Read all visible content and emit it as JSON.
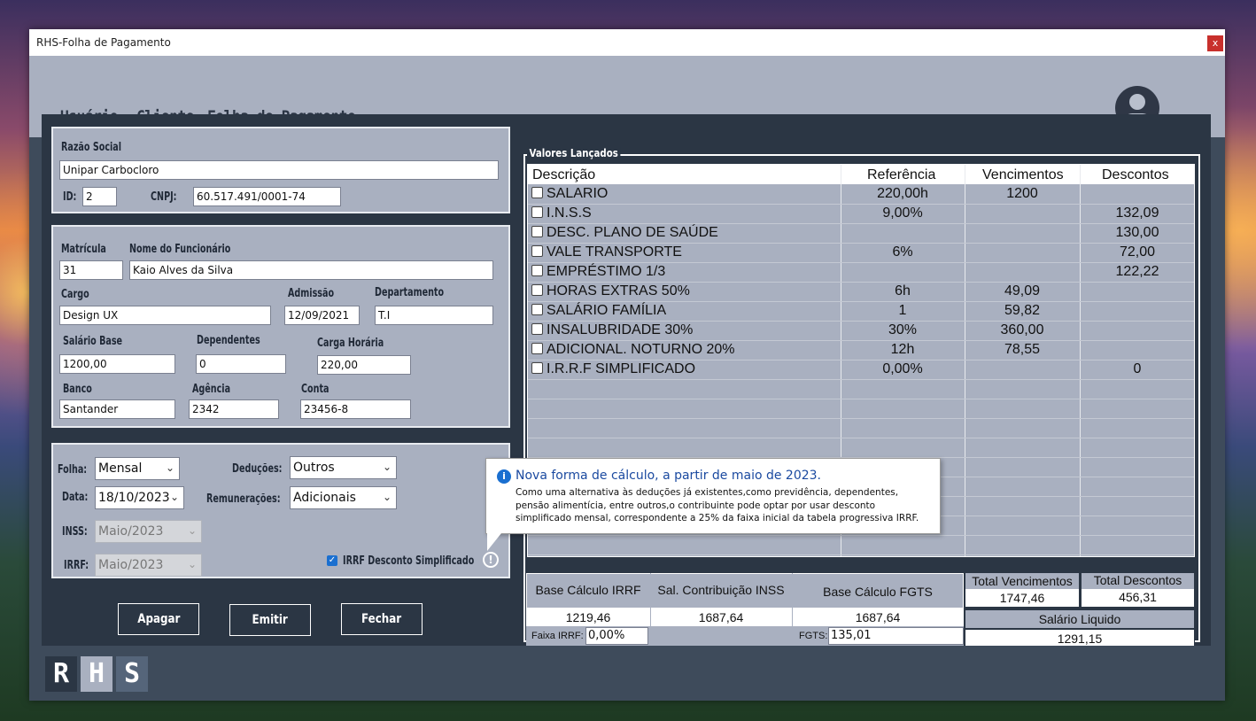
{
  "window": {
    "title": "RHS-Folha de Pagamento",
    "close_label": "x"
  },
  "menu": {
    "items": [
      "Usuário",
      "Cliente",
      "Folha de Pagamento"
    ]
  },
  "empresa": {
    "razao_label": "Razão Social",
    "razao_value": "Unipar Carbocloro",
    "id_label": "ID:",
    "id_value": "2",
    "cnpj_label": "CNPJ:",
    "cnpj_value": "60.517.491/0001-74"
  },
  "funcionario": {
    "matricula_label": "Matrícula",
    "matricula_value": "31",
    "nome_label": "Nome do Funcionário",
    "nome_value": "Kaio Alves da Silva",
    "cargo_label": "Cargo",
    "cargo_value": "Design UX",
    "admissao_label": "Admissão",
    "admissao_value": "12/09/2021",
    "departamento_label": "Departamento",
    "departamento_value": "T.I",
    "salario_label": "Salário Base",
    "salario_value": "1200,00",
    "dependentes_label": "Dependentes",
    "dependentes_value": "0",
    "carga_label": "Carga Horária",
    "carga_value": "220,00",
    "banco_label": "Banco",
    "banco_value": "Santander",
    "agencia_label": "Agência",
    "agencia_value": "2342",
    "conta_label": "Conta",
    "conta_value": "23456-8"
  },
  "folha": {
    "folha_label": "Folha:",
    "folha_value": "Mensal",
    "data_label": "Data:",
    "data_value": "18/10/2023",
    "inss_label": "INSS:",
    "inss_value": "Maio/2023",
    "irrf_label": "IRRF:",
    "irrf_value": "Maio/2023",
    "deducoes_label": "Deduções:",
    "deducoes_value": "Outros",
    "remuneracoes_label": "Remunerações:",
    "remuneracoes_value": "Adicionais",
    "irrf_checkbox_label": "IRRF Desconto Simplificado",
    "irrf_checkbox_checked": true
  },
  "buttons": {
    "apagar": "Apagar",
    "emitir": "Emitir",
    "fechar": "Fechar"
  },
  "valores": {
    "legend": "Valores Lançados",
    "headers": [
      "Descrição",
      "Referência",
      "Vencimentos",
      "Descontos"
    ],
    "rows": [
      {
        "descricao": "SALARIO",
        "referencia": "220,00h",
        "vencimentos": "1200",
        "descontos": ""
      },
      {
        "descricao": "I.N.S.S",
        "referencia": "9,00%",
        "vencimentos": "",
        "descontos": "132,09"
      },
      {
        "descricao": "DESC. PLANO DE SAÚDE",
        "referencia": "",
        "vencimentos": "",
        "descontos": "130,00"
      },
      {
        "descricao": "VALE TRANSPORTE",
        "referencia": "6%",
        "vencimentos": "",
        "descontos": "72,00"
      },
      {
        "descricao": "EMPRÉSTIMO 1/3",
        "referencia": "",
        "vencimentos": "",
        "descontos": "122,22"
      },
      {
        "descricao": "HORAS EXTRAS 50%",
        "referencia": "6h",
        "vencimentos": "49,09",
        "descontos": ""
      },
      {
        "descricao": "SALÁRIO FAMÍLIA",
        "referencia": "1",
        "vencimentos": "59,82",
        "descontos": ""
      },
      {
        "descricao": "INSALUBRIDADE 30%",
        "referencia": "30%",
        "vencimentos": "360,00",
        "descontos": ""
      },
      {
        "descricao": "ADICIONAL. NOTURNO 20%",
        "referencia": "12h",
        "vencimentos": "78,55",
        "descontos": ""
      },
      {
        "descricao": "I.R.R.F SIMPLIFICADO",
        "referencia": "0,00%",
        "vencimentos": "",
        "descontos": "0"
      }
    ]
  },
  "totais": {
    "base_irrf_label": "Base Cálculo IRRF",
    "base_irrf_value": "1219,46",
    "sal_inss_label": "Sal. Contribuição INSS",
    "sal_inss_value": "1687,64",
    "base_fgts_label": "Base Cálculo FGTS",
    "base_fgts_value": "1687,64",
    "total_venc_label": "Total Vencimentos",
    "total_venc_value": "1747,46",
    "total_desc_label": "Total Descontos",
    "total_desc_value": "456,31",
    "liquido_label": "Salário Liquido",
    "liquido_value": "1291,15",
    "faixa_label": "Faixa IRRF:",
    "faixa_value": "0,00%",
    "fgts_label": "FGTS:",
    "fgts_value": "135,01"
  },
  "tooltip": {
    "title": "Nova forma de cálculo, a partir de maio de 2023.",
    "body": "Como uma alternativa às deduções já existentes,como previdência, dependentes, pensão alimentícia, entre outros,o contribuinte pode optar por usar desconto simplificado mensal, correspondente a 25% da faixa inicial da tabela progressiva IRRF."
  },
  "logo": {
    "letters": [
      "R",
      "H",
      "S"
    ]
  },
  "icons": {
    "avatar": "user-circle-icon",
    "info": "info-icon",
    "alert": "exclamation-circle-icon",
    "chevron": "chevron-down-icon"
  }
}
